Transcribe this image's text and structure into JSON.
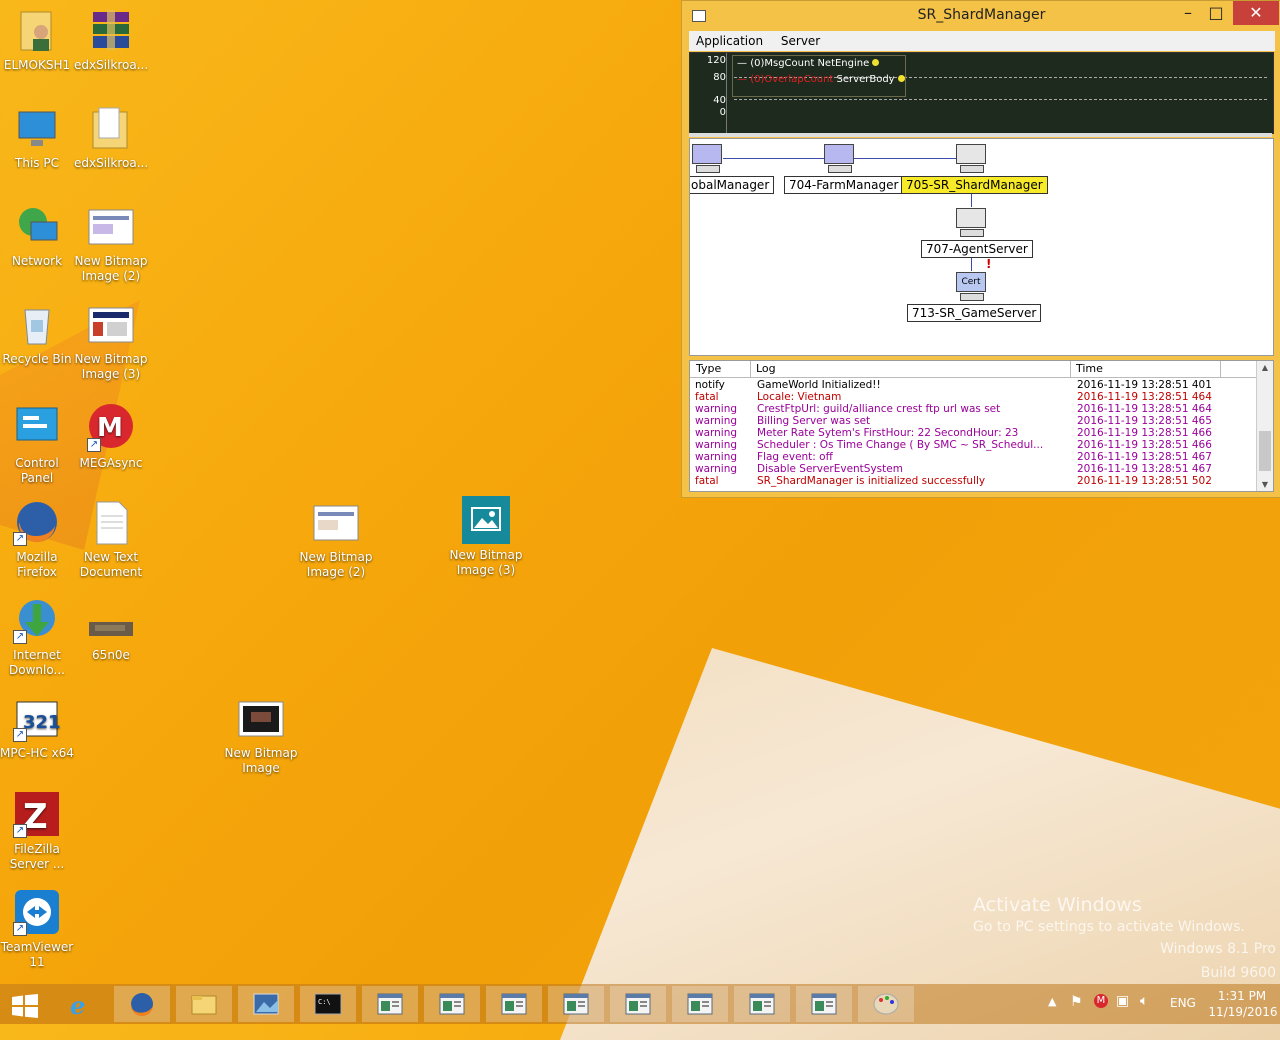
{
  "desktop_icons": [
    {
      "label": "ELMOKSH1"
    },
    {
      "label": "edxSilkroa..."
    },
    {
      "label": "This PC"
    },
    {
      "label": "edxSilkroa..."
    },
    {
      "label": "Network"
    },
    {
      "label": "New Bitmap Image (2)"
    },
    {
      "label": "Recycle Bin"
    },
    {
      "label": "New Bitmap Image (3)"
    },
    {
      "label": "Control Panel"
    },
    {
      "label": "MEGAsync"
    },
    {
      "label": "Mozilla Firefox"
    },
    {
      "label": "New Text Document"
    },
    {
      "label": "New Bitmap Image (2)"
    },
    {
      "label": "New Bitmap Image (3)"
    },
    {
      "label": "Internet Downlo..."
    },
    {
      "label": "65n0e"
    },
    {
      "label": "MPC-HC x64"
    },
    {
      "label": "New Bitmap Image"
    },
    {
      "label": "FileZilla Server ..."
    },
    {
      "label": "TeamViewer 11"
    }
  ],
  "window": {
    "title": "SR_ShardManager",
    "menu": [
      "Application",
      "Server"
    ],
    "graph": {
      "y_ticks": [
        "120",
        "80",
        "40",
        "0"
      ],
      "legend": [
        {
          "prefix": "(0)MsgCount",
          "name": "NetEngine",
          "color": "#ffffff"
        },
        {
          "prefix": "(0)OverlapCount",
          "name": "ServerBody",
          "color": "#e02020"
        }
      ]
    },
    "nodes": {
      "global": "obalManager",
      "farm": "704-FarmManager",
      "shard": "705-SR_ShardManager",
      "agent": "707-AgentServer",
      "game": "713-SR_GameServer",
      "cert_label": "Cert"
    },
    "log": {
      "headers": {
        "type": "Type",
        "log": "Log",
        "time": "Time"
      },
      "rows": [
        {
          "type": "notify",
          "log": "GameWorld Initialized!!",
          "time": "2016-11-19 13:28:51  401",
          "color": "#000000"
        },
        {
          "type": "fatal",
          "log": "Locale: Vietnam",
          "time": "2016-11-19 13:28:51  464",
          "color": "#c00000"
        },
        {
          "type": "warning",
          "log": "CrestFtpUrl: guild/alliance crest ftp url was set",
          "time": "2016-11-19 13:28:51  464",
          "color": "#9a009a"
        },
        {
          "type": "warning",
          "log": "Billing Server was set",
          "time": "2016-11-19 13:28:51  465",
          "color": "#9a009a"
        },
        {
          "type": "warning",
          "log": "Meter Rate Sytem's FirstHour: 22 SecondHour: 23",
          "time": "2016-11-19 13:28:51  466",
          "color": "#9a009a"
        },
        {
          "type": "warning",
          "log": "Scheduler : Os Time Change ( By SMC ~ SR_Schedul...",
          "time": "2016-11-19 13:28:51  466",
          "color": "#9a009a"
        },
        {
          "type": "warning",
          "log": "Flag event: off",
          "time": "2016-11-19 13:28:51  467",
          "color": "#9a009a"
        },
        {
          "type": "warning",
          "log": "Disable ServerEventSystem",
          "time": "2016-11-19 13:28:51  467",
          "color": "#9a009a"
        },
        {
          "type": "fatal",
          "log": "SR_ShardManager is initialized successfully",
          "time": "2016-11-19 13:28:51  502",
          "color": "#c00000"
        }
      ]
    }
  },
  "watermark": {
    "line1": "Activate Windows",
    "line2": "Go to PC settings to activate Windows.",
    "line3": "Windows 8.1 Pro",
    "line4": "Build 9600"
  },
  "taskbar": {
    "apps": [
      "start",
      "internet-explorer",
      "firefox",
      "file-explorer",
      "photos",
      "cmd",
      "window",
      "window",
      "window",
      "window",
      "window",
      "window",
      "window",
      "window",
      "paint"
    ],
    "tray": {
      "lang": "ENG",
      "time": "1:31 PM",
      "date": "11/19/2016"
    }
  }
}
